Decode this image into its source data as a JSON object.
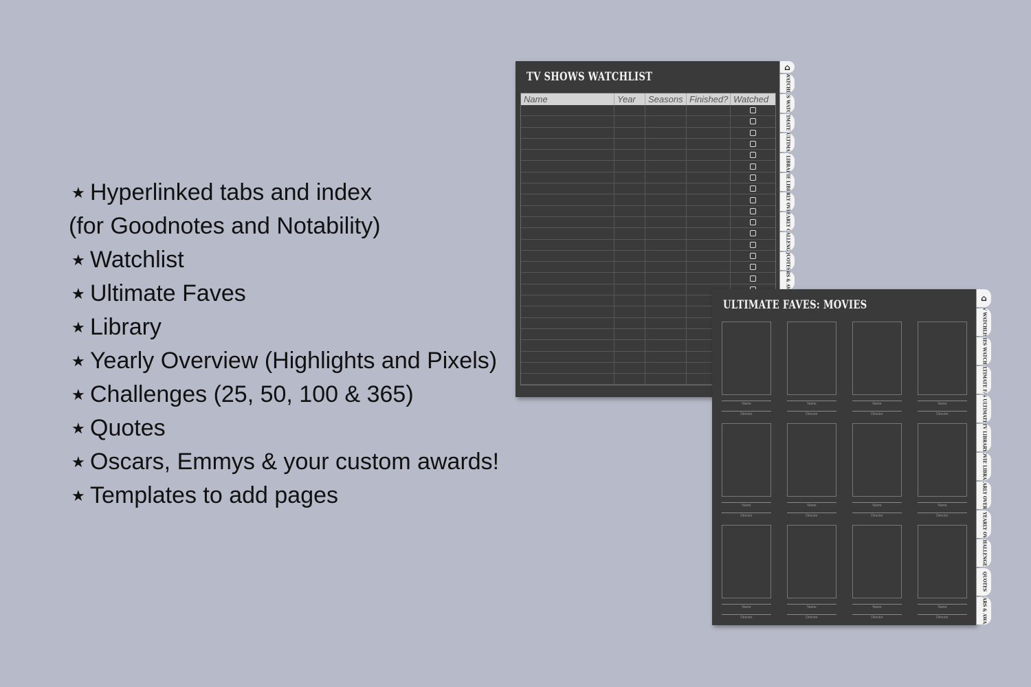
{
  "features": [
    {
      "star": "★",
      "text": "Hyperlinked tabs and index"
    },
    {
      "star": "",
      "text": "(for Goodnotes and Notability)"
    },
    {
      "star": "★",
      "text": "Watchlist"
    },
    {
      "star": "★",
      "text": "Ultimate Faves"
    },
    {
      "star": "★",
      "text": "Library"
    },
    {
      "star": "★",
      "text": "Yearly Overview (Highlights and Pixels)"
    },
    {
      "star": "★",
      "text": "Challenges (25, 50, 100 & 365)"
    },
    {
      "star": "★",
      "text": "Quotes"
    },
    {
      "star": "★",
      "text": "Oscars, Emmys & your custom awards!"
    },
    {
      "star": "★",
      "text": "Templates to add pages"
    }
  ],
  "watchlist": {
    "title": "TV SHOWS WATCHLIST",
    "columns": [
      "Name",
      "Year",
      "Seasons",
      "Finished?",
      "Watched"
    ]
  },
  "faves": {
    "title": "ULTIMATE FAVES: MOVIES",
    "name_label": "Name",
    "director_label": "Director"
  },
  "tabs": {
    "home_icon": "home-icon",
    "home_glyph": "⌂",
    "labels": [
      "TV WATCHLIST",
      "MOVIES WATCHLIST",
      "TV ULTIMATE FAVES",
      "MOVIES ULTIMATE FAVES",
      "TV LIBRARY",
      "MOVIE LIBRARY",
      "TV YEARLY OVERVIEW",
      "MOVIES YEARLY OVERVIEW",
      "CHALLENGES",
      "QUOTES",
      "OSCARS & AWARDS"
    ]
  },
  "colors": {
    "background": "#b7bac8",
    "page": "#3a3a3a",
    "tab": "#f4f4f4"
  }
}
